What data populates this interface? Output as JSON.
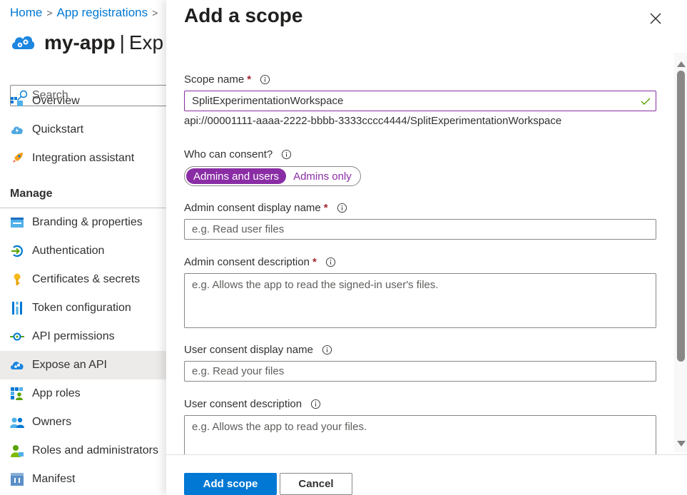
{
  "breadcrumb": [
    {
      "label": "Home"
    },
    {
      "label": "App registrations"
    }
  ],
  "app": {
    "name": "my-app",
    "page": "Expose an API",
    "page_visible": "Exp"
  },
  "search": {
    "placeholder": "Search"
  },
  "sidebar": {
    "items_top": [
      {
        "label": "Overview",
        "icon": "overview-icon"
      },
      {
        "label": "Quickstart",
        "icon": "quickstart-icon"
      },
      {
        "label": "Integration assistant",
        "icon": "rocket-icon"
      }
    ],
    "section_label": "Manage",
    "items_manage": [
      {
        "label": "Branding & properties",
        "icon": "branding-icon"
      },
      {
        "label": "Authentication",
        "icon": "authentication-icon"
      },
      {
        "label": "Certificates & secrets",
        "icon": "key-icon"
      },
      {
        "label": "Token configuration",
        "icon": "token-icon"
      },
      {
        "label": "API permissions",
        "icon": "api-permissions-icon"
      },
      {
        "label": "Expose an API",
        "icon": "expose-api-icon",
        "active": true
      },
      {
        "label": "App roles",
        "icon": "app-roles-icon"
      },
      {
        "label": "Owners",
        "icon": "owners-icon"
      },
      {
        "label": "Roles and administrators",
        "icon": "roles-icon"
      },
      {
        "label": "Manifest",
        "icon": "manifest-icon"
      }
    ]
  },
  "panel": {
    "title": "Add a scope",
    "scope_name": {
      "label": "Scope name",
      "required": "*",
      "value": "SplitExperimentationWorkspace",
      "uri": "api://00001111-aaaa-2222-bbbb-3333cccc4444/SplitExperimentationWorkspace"
    },
    "who_can_consent": {
      "label": "Who can consent?",
      "options": [
        "Admins and users",
        "Admins only"
      ],
      "selected": "Admins and users"
    },
    "admin_display_name": {
      "label": "Admin consent display name",
      "required": "*",
      "placeholder": "e.g. Read user files"
    },
    "admin_description": {
      "label": "Admin consent description",
      "required": "*",
      "placeholder": "e.g. Allows the app to read the signed-in user's files."
    },
    "user_display_name": {
      "label": "User consent display name",
      "placeholder": "e.g. Read your files"
    },
    "user_description": {
      "label": "User consent description",
      "placeholder": "e.g. Allows the app to read your files."
    },
    "buttons": {
      "add": "Add scope",
      "cancel": "Cancel"
    }
  },
  "colors": {
    "accent_blue": "#0078d4",
    "toggle_purple": "#8a2da5",
    "required_red": "#a4262c",
    "valid_green": "#57a300"
  }
}
